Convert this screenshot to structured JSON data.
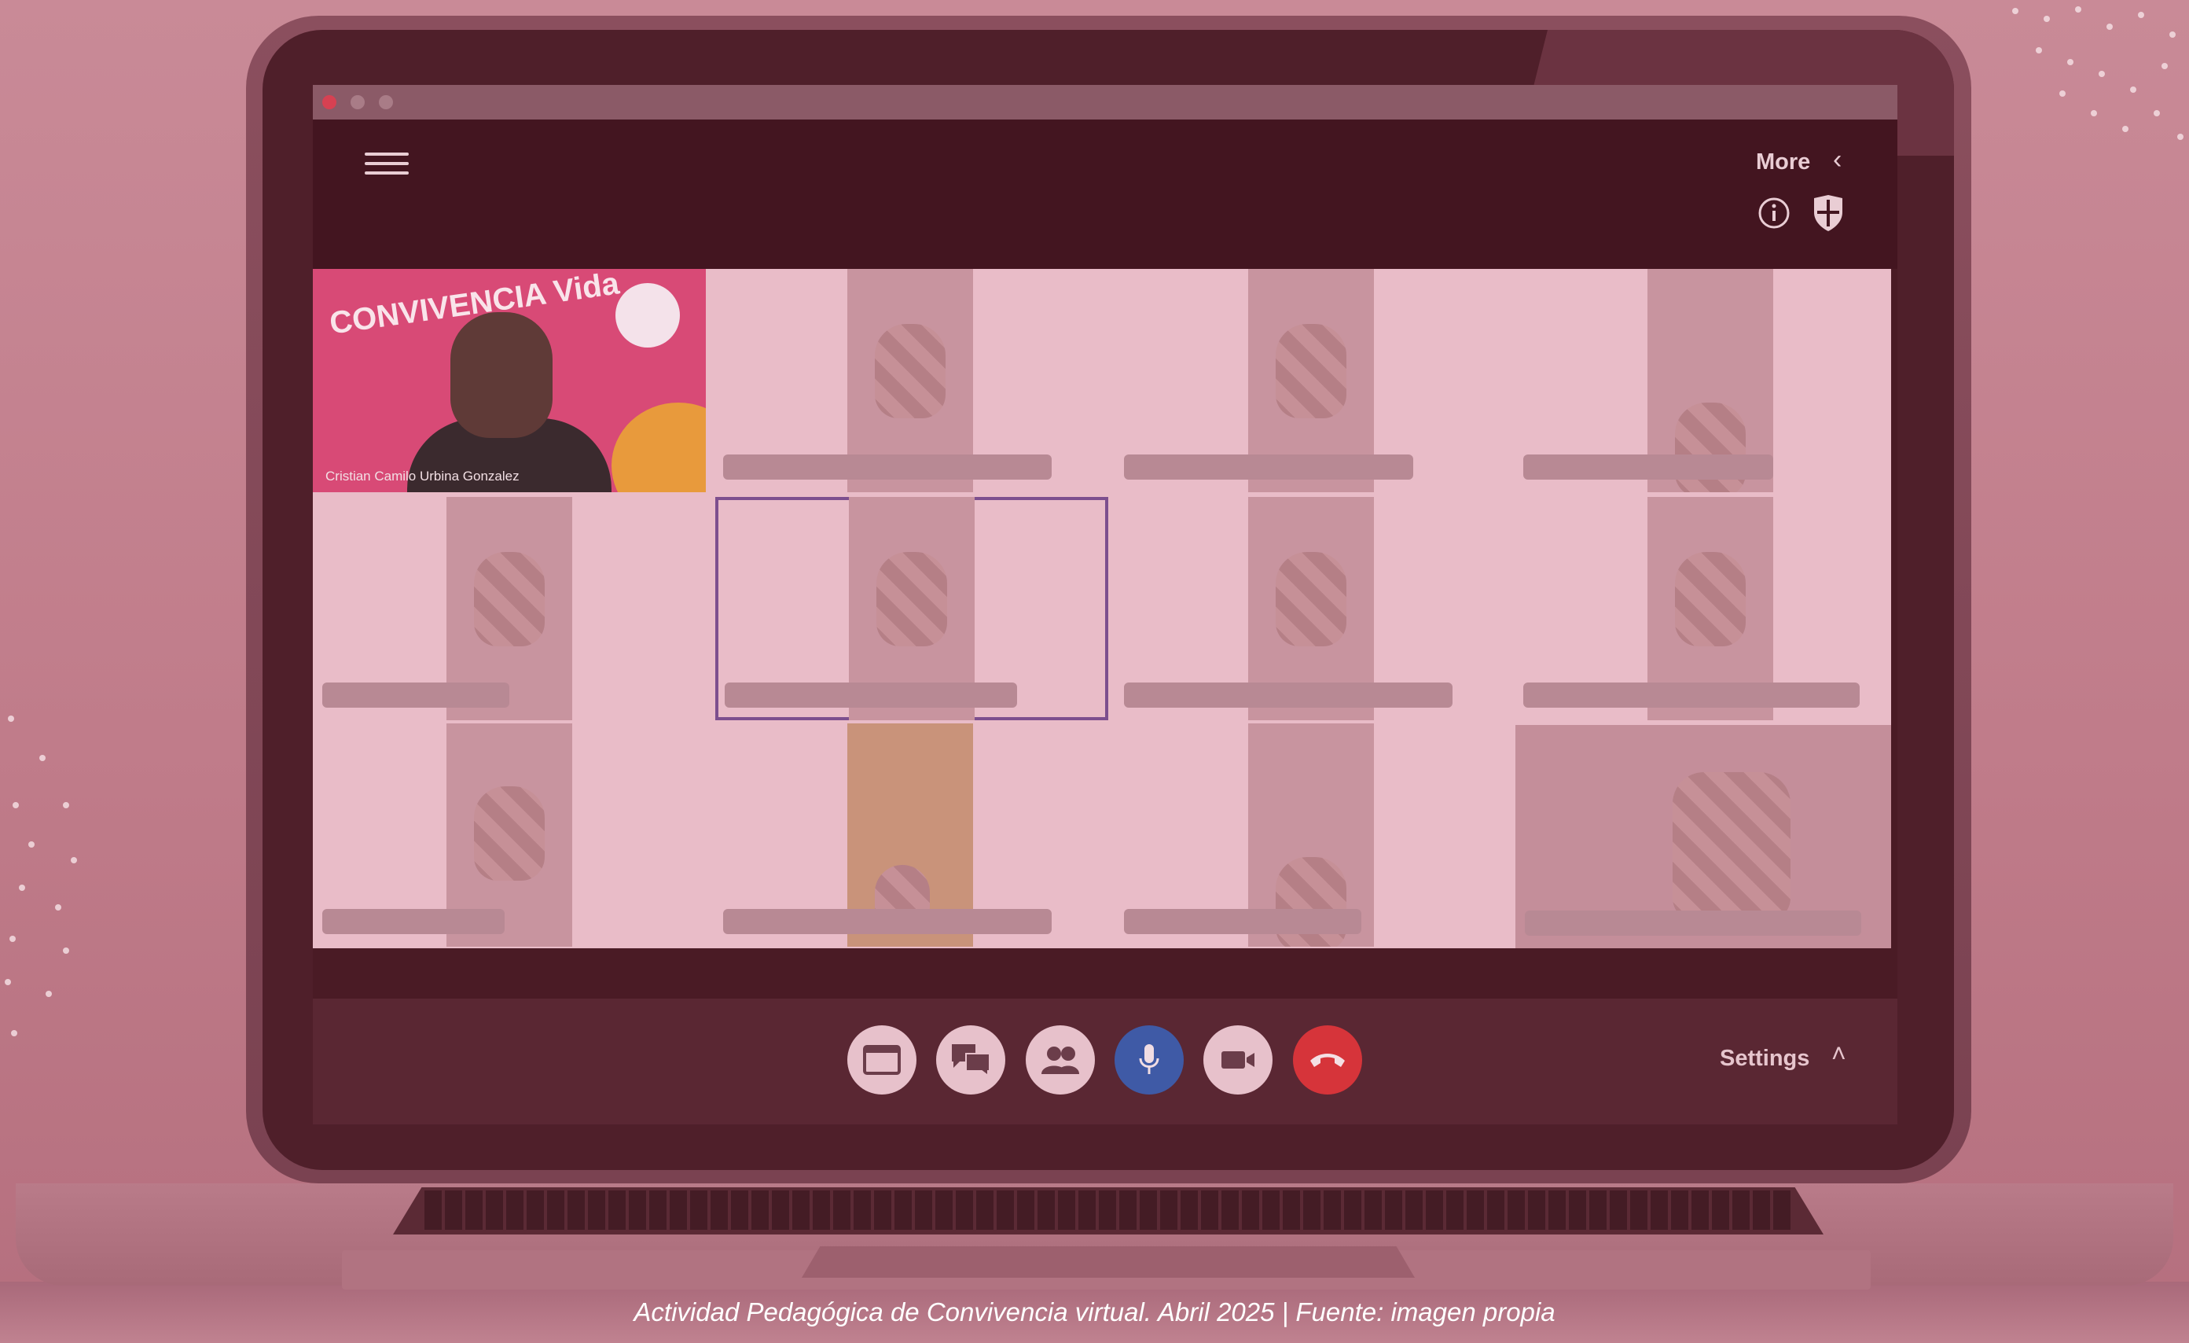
{
  "app": {
    "more_label": "More",
    "settings_label": "Settings"
  },
  "participants": {
    "presenter_name": "Cristian Camilo Urbina Gonzalez",
    "presenter_banner": "CONVIVENCIA Vida"
  },
  "controls": [
    {
      "icon": "screen-share-icon"
    },
    {
      "icon": "chat-icon"
    },
    {
      "icon": "participants-icon"
    },
    {
      "icon": "microphone-icon",
      "color": "#3f5aa6"
    },
    {
      "icon": "camera-icon"
    },
    {
      "icon": "hang-up-icon",
      "color": "#d6343a"
    }
  ],
  "caption": "Actividad Pedagógica de Convivencia virtual. Abril 2025 | Fuente: imagen propia",
  "colors": {
    "overlay": "#c98a97",
    "active_border": "#7d4f8e",
    "mic": "#3f5aa6",
    "hangup": "#d6343a"
  }
}
